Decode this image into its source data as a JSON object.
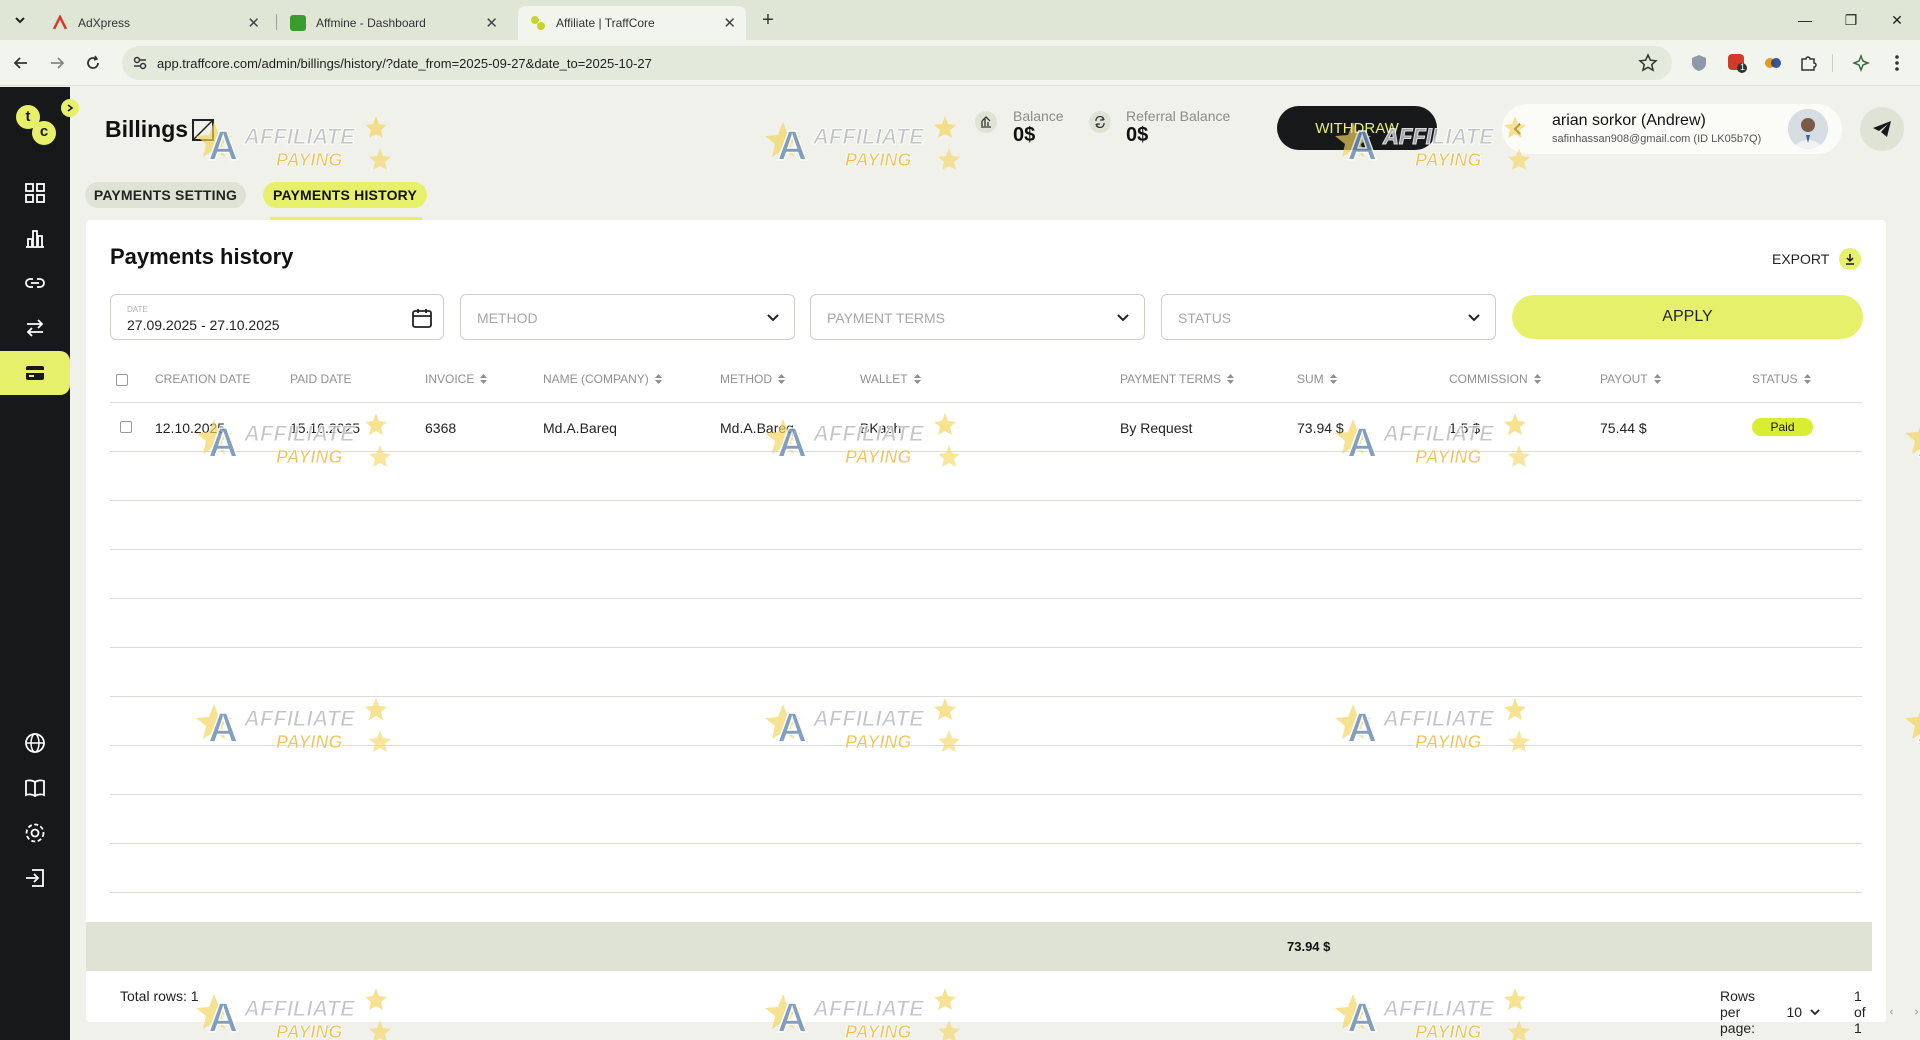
{
  "browser": {
    "tabs": [
      {
        "title": "AdXpress",
        "color": "#d23b2a"
      },
      {
        "title": "Affmine - Dashboard",
        "color": "#3b9b2f"
      },
      {
        "title": "Affiliate | TraffCore",
        "color": "#c9d52b"
      }
    ],
    "url": "app.traffcore.com/admin/billings/history/?date_from=2025-09-27&date_to=2025-10-27",
    "extension_badge": "1"
  },
  "sidebar": {
    "logo_letters": [
      "t",
      "c"
    ],
    "items": [
      "dashboard-icon",
      "statistics-icon",
      "link-icon",
      "exchange-icon",
      "card-icon",
      "globe-icon",
      "book-icon",
      "settings-icon",
      "logout-icon"
    ]
  },
  "header": {
    "title": "Billings",
    "balance": {
      "label": "Balance",
      "value": "0$"
    },
    "referral": {
      "label": "Referral Balance",
      "value": "0$"
    },
    "withdraw": "WITHDRAW",
    "user": {
      "name": "arian sorkor (Andrew)",
      "email": "safinhassan908@gmail.com (ID LK05b7Q)"
    }
  },
  "subtabs": {
    "setting": "PAYMENTS SETTING",
    "history": "PAYMENTS HISTORY"
  },
  "card": {
    "title": "Payments history",
    "export": "EXPORT",
    "filters": {
      "date_label": "DATE",
      "date_value": "27.09.2025 - 27.10.2025",
      "method": "METHOD",
      "terms": "PAYMENT TERMS",
      "status": "STATUS",
      "apply": "APPLY"
    },
    "columns": [
      "CREATION DATE",
      "PAID DATE",
      "INVOICE",
      "NAME (COMPANY)",
      "METHOD",
      "WALLET",
      "PAYMENT TERMS",
      "SUM",
      "COMMISSION",
      "PAYOUT",
      "STATUS"
    ],
    "rows": [
      {
        "created": "12.10.2025",
        "paid": "15.10.2025",
        "invoice": "6368",
        "name": "Md.A.Bareq",
        "method": "Md.A.Bareq",
        "wallet": "BKash",
        "terms": "By Request",
        "sum": "73.94 $",
        "commission": "1.5 $",
        "payout": "75.44 $",
        "status": "Paid"
      }
    ],
    "totals": {
      "sum": "73.94 $"
    },
    "footer": {
      "total_rows": "Total rows: 1",
      "rows_per_page_label": "Rows per page:",
      "rows_per_page": "10",
      "page": "1 of 1"
    }
  },
  "watermark": {
    "line1": "AFFILIATE",
    "line2": "PAYING",
    "letter": "A"
  },
  "colors": {
    "accent": "#e7f06a",
    "sidebar": "#17181a",
    "background": "#f0f1ea",
    "paid": "#d9ee32"
  }
}
